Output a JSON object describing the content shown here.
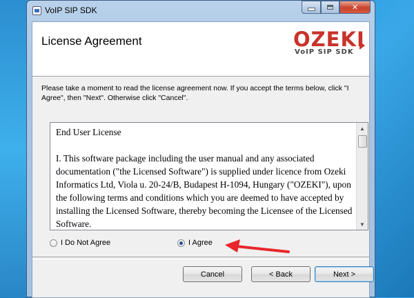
{
  "window": {
    "title": "VoIP SIP SDK",
    "min_icon": "minimize-icon",
    "max_icon": "maximize-icon",
    "close_icon": "close-icon",
    "close_glyph": "✕"
  },
  "header": {
    "title": "License Agreement",
    "logo_main": "OZEKI",
    "logo_sub": "VoIP SIP SDK"
  },
  "instructions": "Please take a moment to read the license agreement now. If you accept the terms below, click \"I Agree\", then \"Next\". Otherwise click \"Cancel\".",
  "license": {
    "heading": "End User License",
    "paragraph": "I. This software package including the user manual and any associated documentation (\"the Licensed Software\") is supplied under licence from Ozeki Informatics Ltd, Viola u. 20-24/B, Budapest H-1094, Hungary (\"OZEKI\"), upon the following terms and conditions which you are deemed to have accepted by installing the Licensed Software, thereby becoming the Licensee of the Licensed Software."
  },
  "options": {
    "disagree_label": "I Do Not Agree",
    "agree_label": "I Agree",
    "selected": "agree"
  },
  "buttons": {
    "cancel": "Cancel",
    "back": "< Back",
    "next": "Next >"
  },
  "colors": {
    "accent": "#c9332b",
    "arrow": "#e8262b"
  }
}
